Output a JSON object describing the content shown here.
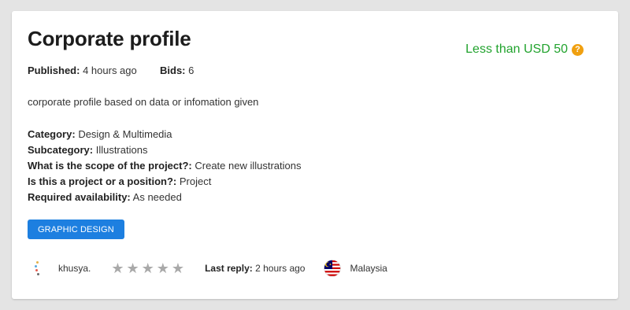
{
  "project": {
    "title": "Corporate profile",
    "budget": "Less than USD 50",
    "published_label": "Published:",
    "published_value": "4 hours ago",
    "bids_label": "Bids:",
    "bids_value": "6",
    "description": "corporate profile based on data or infomation given"
  },
  "details": [
    {
      "label": "Category:",
      "value": "Design & Multimedia"
    },
    {
      "label": "Subcategory:",
      "value": "Illustrations"
    },
    {
      "label": "What is the scope of the project?:",
      "value": "Create new illustrations"
    },
    {
      "label": "Is this a project or a position?:",
      "value": "Project"
    },
    {
      "label": "Required availability:",
      "value": "As needed"
    }
  ],
  "tag": "GRAPHIC DESIGN",
  "footer": {
    "username": "khusya.",
    "rating_stars_filled": 0,
    "rating_stars_total": 5,
    "last_reply_label": "Last reply:",
    "last_reply_value": "2 hours ago",
    "country": "Malaysia"
  },
  "icons": {
    "help": "question-circle-icon",
    "star": "star-icon",
    "flag": "malaysia-flag-icon"
  },
  "colors": {
    "budget": "#22a32e",
    "tag_bg": "#1d7fe0",
    "help_icon": "#f0a010",
    "star_empty": "#a9a9a9"
  }
}
